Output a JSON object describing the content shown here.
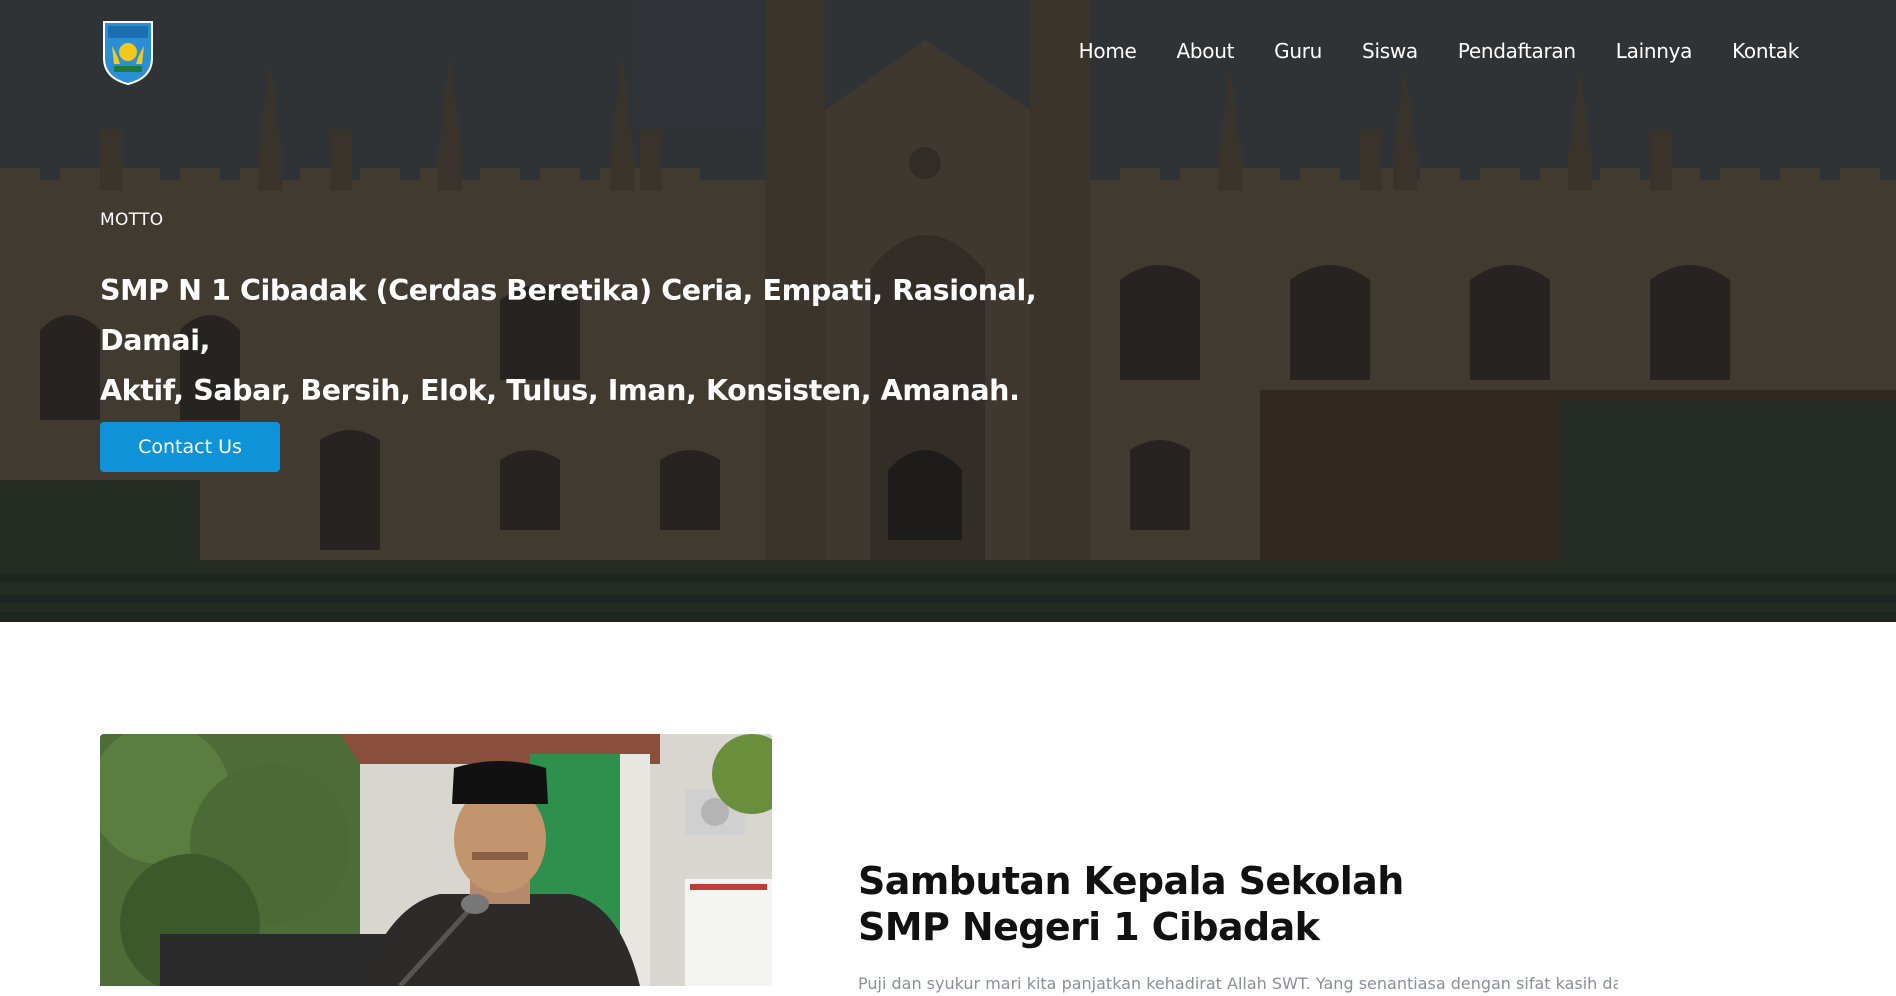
{
  "header": {
    "logo_icon": "school-crest-icon",
    "nav": [
      {
        "label": "Home"
      },
      {
        "label": "About"
      },
      {
        "label": "Guru"
      },
      {
        "label": "Siswa"
      },
      {
        "label": "Pendaftaran"
      },
      {
        "label": "Lainnya"
      },
      {
        "label": "Kontak"
      }
    ]
  },
  "hero": {
    "label": "MOTTO",
    "line1": "SMP N 1 Cibadak (Cerdas Beretika) Ceria, Empati, Rasional, Damai,",
    "line2": "Aktif, Sabar, Bersih, Elok, Tulus, Iman, Konsisten, Amanah.",
    "button_label": "Contact Us",
    "colors": {
      "button": "#0e93d8",
      "text": "#ffffff"
    }
  },
  "sambutan": {
    "title_line1": "Sambutan Kepala Sekolah",
    "title_line2": "SMP Negeri 1 Cibadak",
    "body": "Puji dan syukur mari kita panjatkan kehadirat Allah SWT. Yang senantiasa dengan sifat kasih dan"
  }
}
